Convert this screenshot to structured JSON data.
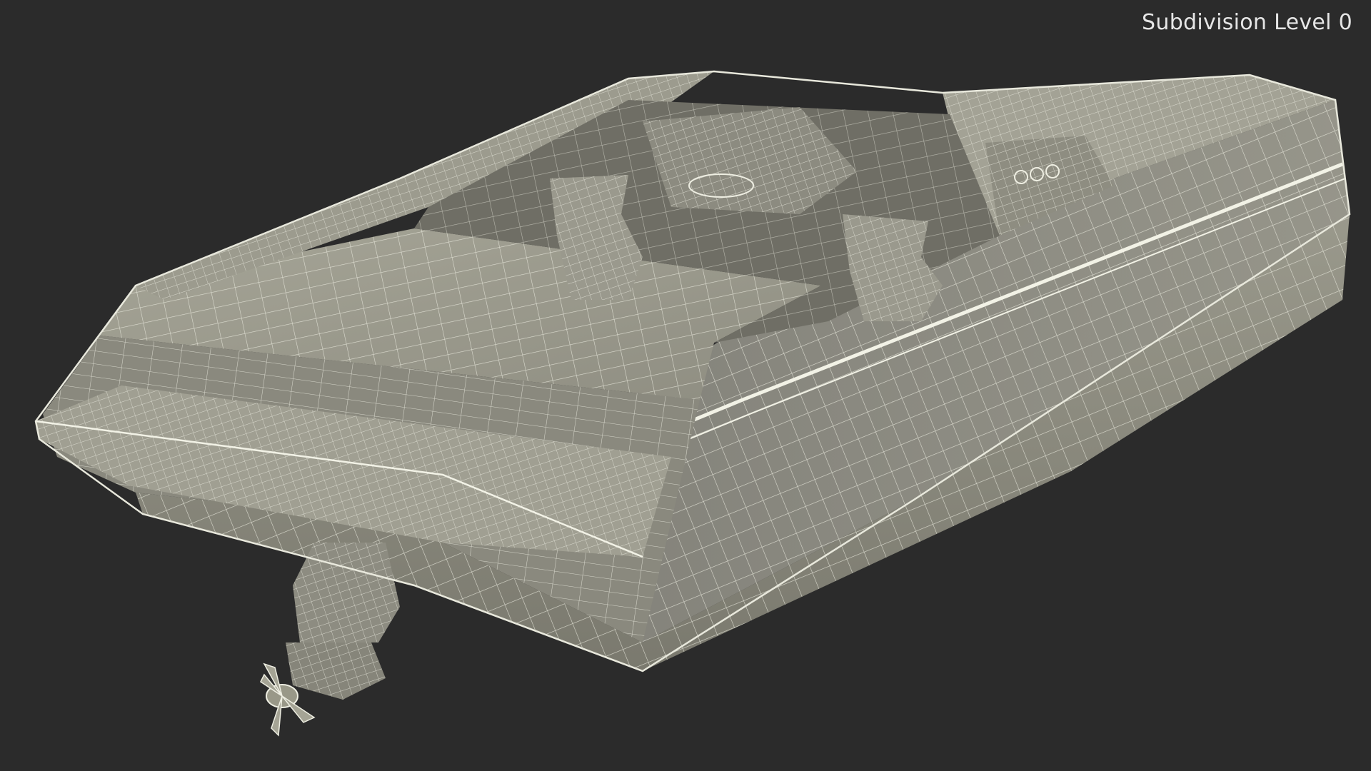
{
  "viewport": {
    "background_color": "#2b2b2b",
    "label": "Subdivision Level 0"
  },
  "model": {
    "subject": "speedboat-wireframe",
    "surface_color": "#8b8a7e",
    "wire_color": "#e8e8dc"
  }
}
